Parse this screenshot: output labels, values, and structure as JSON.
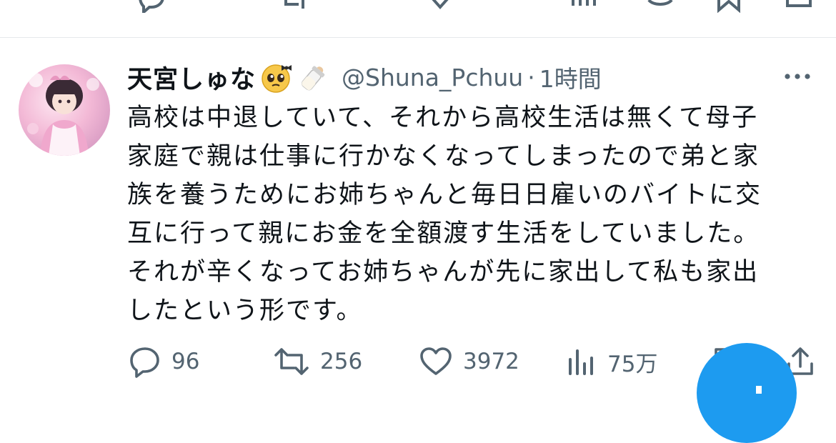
{
  "tweet": {
    "display_name": "天宮しゅな",
    "name_emojis": [
      "pleading-face-with-bow-emoji",
      "baby-bottle-emoji"
    ],
    "handle": "@Shuna_Pchuu",
    "separator": "·",
    "time": "1時間",
    "text": "高校は中退していて、それから高校生活は無くて母子\n家庭で親は仕事に行かなくなってしまったので弟と家\n族を養うためにお姉ちゃんと毎日日雇いのバイトに交\n互に行って親にお金を全額渡す生活をしていました。\nそれが辛くなってお姉ちゃんが先に家出して私も家出\nしたという形です。"
  },
  "actions": {
    "replies": "96",
    "retweets": "256",
    "likes": "3972",
    "views": "75万"
  },
  "colors": {
    "text": "#0f1419",
    "secondary": "#536471",
    "accent": "#1d9bf0",
    "divider": "#e6e9ec"
  },
  "icons": [
    "reply-icon",
    "retweet-icon",
    "like-icon",
    "views-icon",
    "bookmark-icon",
    "share-icon",
    "more-icon",
    "compose-fab"
  ]
}
